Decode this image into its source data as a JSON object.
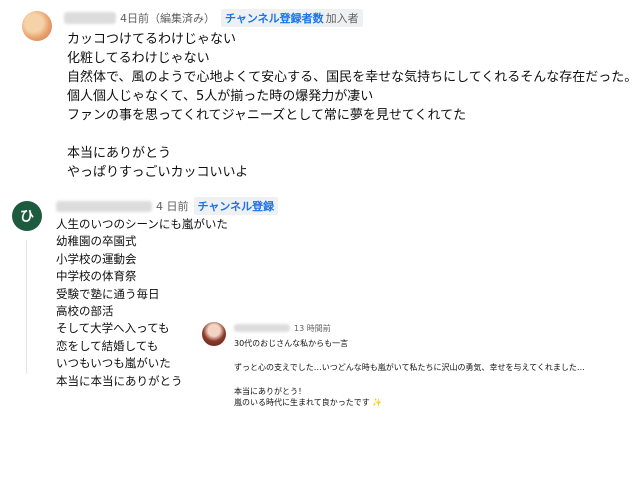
{
  "comment1": {
    "meta": {
      "time": "4日前（編集済み）",
      "badge_main": "チャンネル登録者数",
      "badge_sub": "加入者"
    },
    "lines": [
      "カッコつけてるわけじゃない",
      "化粧してるわけじゃない",
      "自然体で、風のようで心地よくて安心する、国民を幸せな気持ちにしてくれるそんな存在だった。",
      "個人個人じゃなくて、5人が揃った時の爆発力が凄い",
      "ファンの事を思ってくれてジャニーズとして常に夢を見せてくれてた",
      "",
      "本当にありがとう",
      "やっぱりすっごいカッコいいよ"
    ]
  },
  "comment2": {
    "avatar_letter": "ひ",
    "meta": {
      "time": "4 日前",
      "badge_main": "チャンネル登録"
    },
    "lines": [
      "人生のいつのシーンにも嵐がいた",
      "幼稚園の卒園式",
      "小学校の運動会",
      "中学校の体育祭",
      "受験で塾に通う毎日",
      "高校の部活",
      "そして大学へ入っても",
      "恋をして結婚しても",
      "いつもいつも嵐がいた",
      "本当に本当にありがとう"
    ]
  },
  "reply": {
    "meta": {
      "time": "13 時間前"
    },
    "lines": [
      "30代のおじさんな私からも一言",
      "",
      "ずっと心の支えでした…いつどんな時も嵐がいて私たちに沢山の勇気、幸せを与えてくれました…",
      "",
      "本当にありがとう！",
      "嵐のいる時代に生まれて良かったです ✨"
    ]
  },
  "colors": {
    "badge_blue": "#1a73e8",
    "meta_gray": "#606060",
    "avatar2_bg": "#1d5b3f"
  }
}
